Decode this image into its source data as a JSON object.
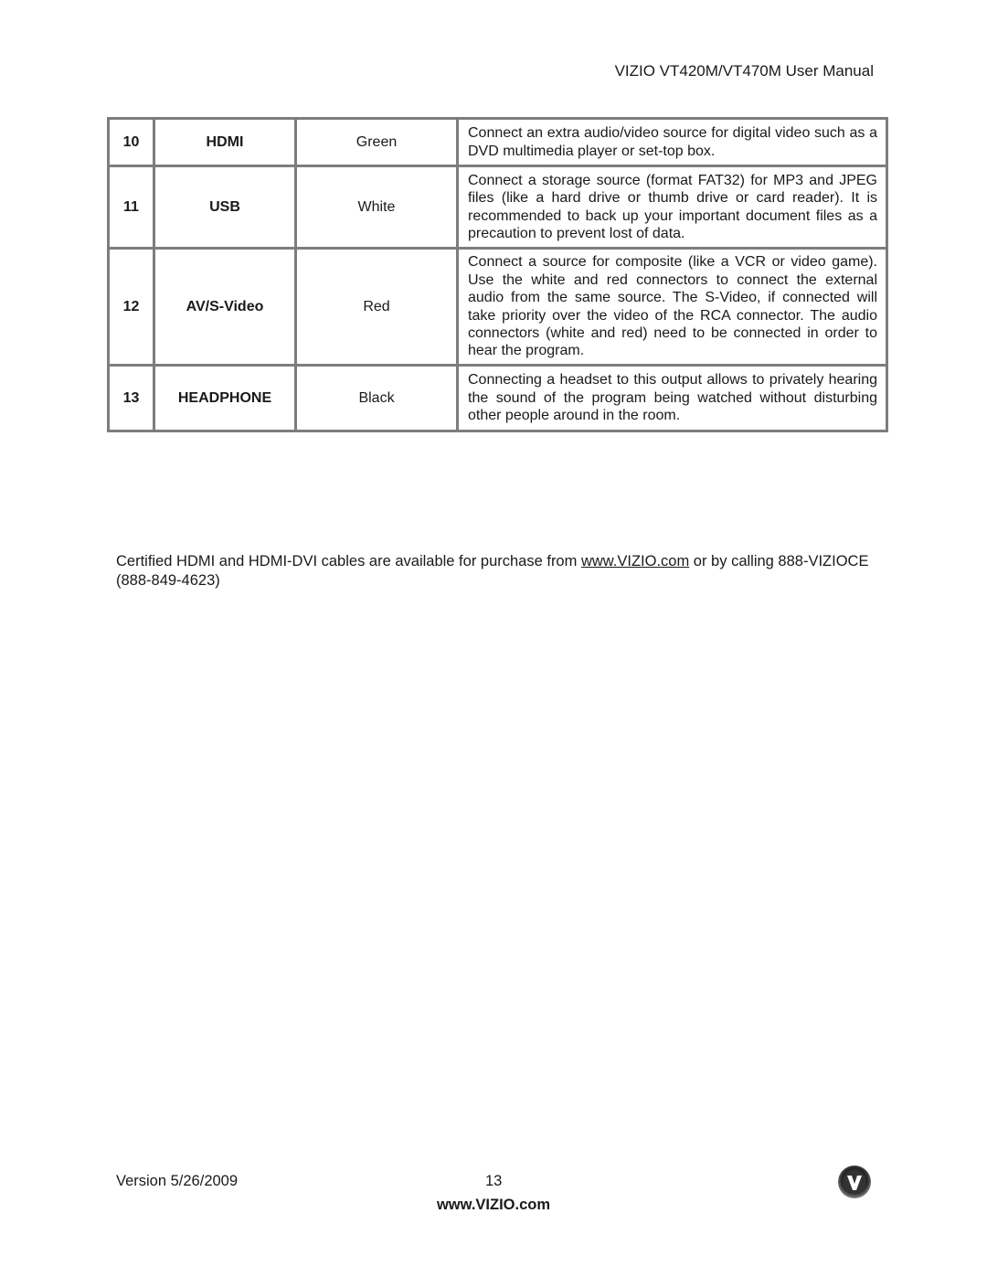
{
  "header": {
    "title": "VIZIO VT420M/VT470M User Manual"
  },
  "table": {
    "rows": [
      {
        "num": "10",
        "name": "HDMI",
        "color": "Green",
        "description": "Connect an extra audio/video source for digital video such as a DVD multimedia player or set-top box."
      },
      {
        "num": "11",
        "name": "USB",
        "color": "White",
        "description": "Connect a storage source (format FAT32) for MP3 and JPEG files (like a hard drive or thumb drive or card reader). It is recommended to back up your important document files as a precaution to prevent lost of data."
      },
      {
        "num": "12",
        "name": "AV/S-Video",
        "color": "Red",
        "description": "Connect a source for composite (like a VCR or video game). Use the white and red connectors to connect the external audio from the same source. The S-Video, if connected will take priority over the video of the RCA connector. The audio connectors (white and red) need to be connected in order to hear the program."
      },
      {
        "num": "13",
        "name": "HEADPHONE",
        "color": "Black",
        "description": "Connecting a headset to this output allows to privately hearing the sound of the program being watched without disturbing other people around in the room."
      }
    ]
  },
  "note": {
    "before_link": "Certified HDMI and HDMI-DVI cables are available for purchase from ",
    "link": "www.VIZIO.com",
    "after_link": " or by calling 888-VIZIOCE (888-849-4623)"
  },
  "footer": {
    "version": "Version 5/26/2009",
    "page_number": "13",
    "url": "www.VIZIO.com",
    "logo_icon": "vizio-v-logo-icon"
  }
}
